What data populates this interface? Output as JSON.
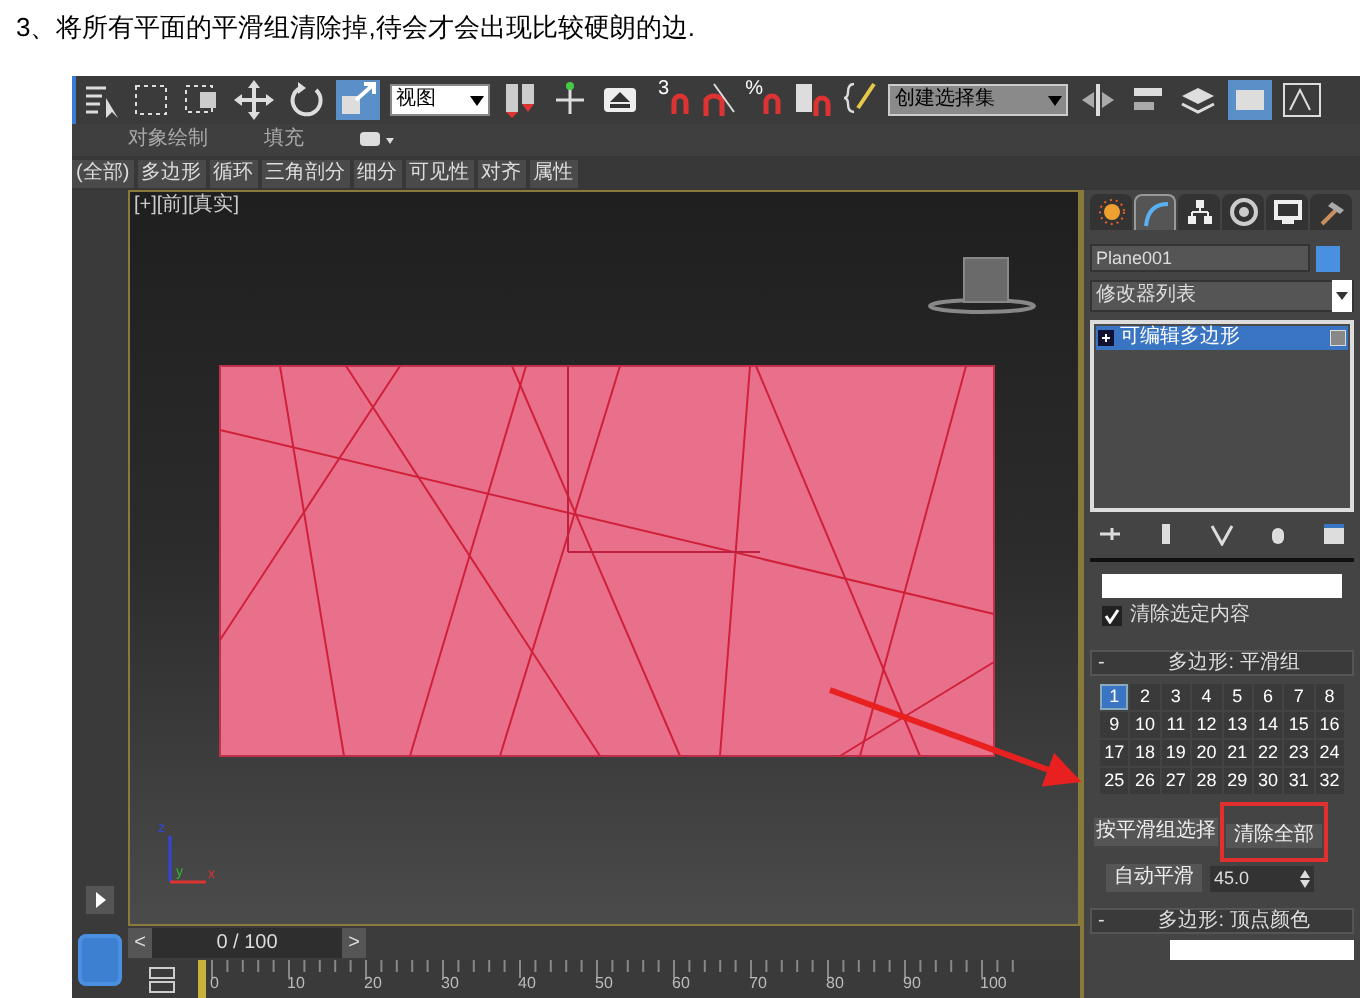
{
  "caption": "3、将所有平面的平滑组清除掉,待会才会出现比较硬朗的边.",
  "toolbar": {
    "view_dropdown": "视图",
    "snap_labels": [
      "3",
      "%"
    ],
    "selection_set": "创建选择集"
  },
  "ribbon": [
    "对象绘制",
    "填充"
  ],
  "ribbon_tabs": [
    "(全部)",
    "多边形",
    "循环",
    "三角剖分",
    "细分",
    "可见性",
    "对齐",
    "属性"
  ],
  "viewport": {
    "label": "[+][前][真实]",
    "axis_labels": [
      "z",
      "y",
      "x"
    ]
  },
  "time_slider": {
    "prev": "<",
    "reading": "0 / 100",
    "next": ">",
    "level": 0
  },
  "timeline": [
    "0",
    "10",
    "20",
    "30",
    "40",
    "50",
    "60",
    "70",
    "80",
    "90",
    "100"
  ],
  "panel_tabs": [
    {
      "kind": "create",
      "selected": false
    },
    {
      "kind": "modify",
      "selected": true
    },
    {
      "kind": "hierarchy",
      "selected": false
    },
    {
      "kind": "motion",
      "selected": false
    },
    {
      "kind": "display",
      "selected": false
    },
    {
      "kind": "utilities",
      "selected": false
    }
  ],
  "object_name": "Plane001",
  "modifier_list": "修改器列表",
  "modifier_stack": [
    {
      "label": "可编辑多边形",
      "selected": true
    }
  ],
  "clear_selection": {
    "label": "清除选定内容",
    "checked": true
  },
  "smoothing_groups": {
    "collapse_sign": "-",
    "title": "多边形: 平滑组",
    "groups": [
      {
        "label": "1",
        "selected": true
      },
      {
        "label": "2",
        "selected": false
      },
      {
        "label": "3",
        "selected": false
      },
      {
        "label": "4",
        "selected": false
      },
      {
        "label": "5",
        "selected": false
      },
      {
        "label": "6",
        "selected": false
      },
      {
        "label": "7",
        "selected": false
      },
      {
        "label": "8",
        "selected": false
      },
      {
        "label": "9",
        "selected": false
      },
      {
        "label": "10",
        "selected": false
      },
      {
        "label": "11",
        "selected": false
      },
      {
        "label": "12",
        "selected": false
      },
      {
        "label": "13",
        "selected": false
      },
      {
        "label": "14",
        "selected": false
      },
      {
        "label": "15",
        "selected": false
      },
      {
        "label": "16",
        "selected": false
      },
      {
        "label": "17",
        "selected": false
      },
      {
        "label": "18",
        "selected": false
      },
      {
        "label": "19",
        "selected": false
      },
      {
        "label": "20",
        "selected": false
      },
      {
        "label": "21",
        "selected": false
      },
      {
        "label": "22",
        "selected": false
      },
      {
        "label": "23",
        "selected": false
      },
      {
        "label": "24",
        "selected": false
      },
      {
        "label": "25",
        "selected": false
      },
      {
        "label": "26",
        "selected": false
      },
      {
        "label": "27",
        "selected": false
      },
      {
        "label": "28",
        "selected": false
      },
      {
        "label": "29",
        "selected": false
      },
      {
        "label": "30",
        "selected": false
      },
      {
        "label": "31",
        "selected": false
      },
      {
        "label": "32",
        "selected": false
      }
    ],
    "select_by": "按平滑组选择",
    "clear_all": "清除全部",
    "auto_smooth": "自动平滑",
    "threshold": "45.0"
  },
  "vertex_colors": {
    "collapse_sign": "-",
    "title": "多边形: 顶点颜色"
  }
}
